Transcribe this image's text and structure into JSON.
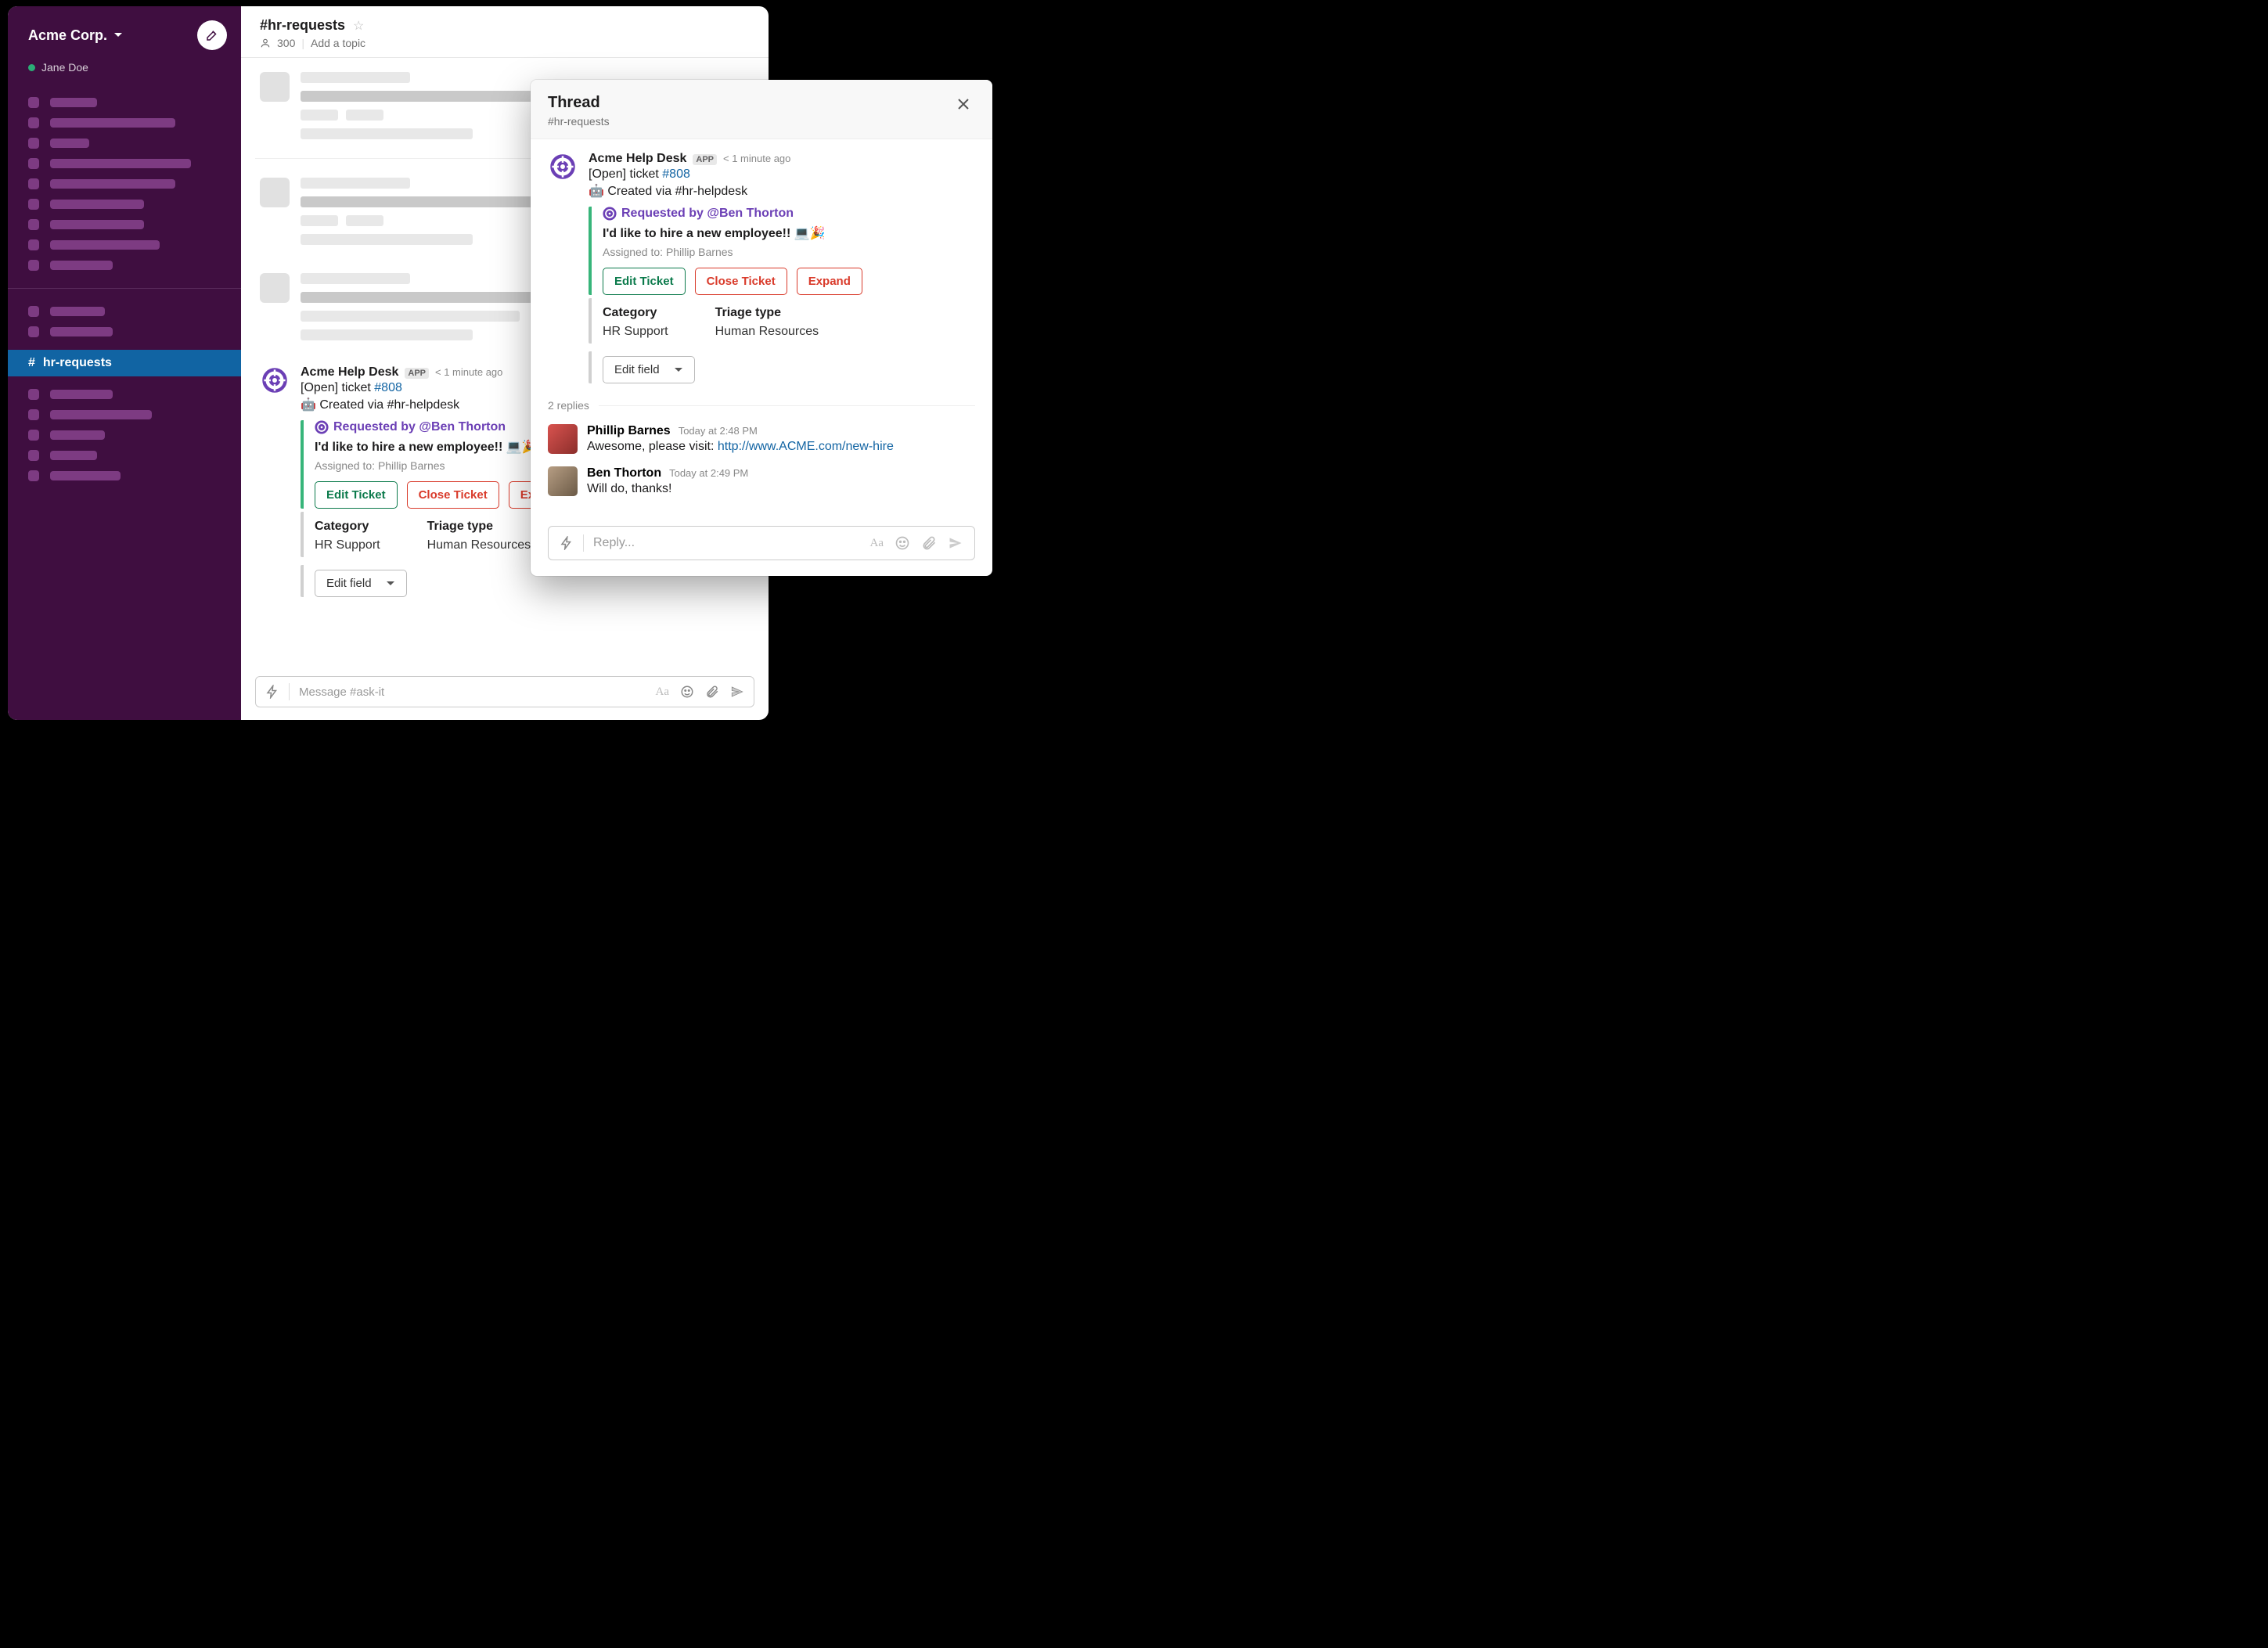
{
  "sidebar": {
    "workspace": "Acme Corp.",
    "user": "Jane Doe",
    "active_channel": "hr-requests",
    "skeleton_widths_top": [
      60,
      160,
      50,
      180,
      160,
      120,
      120,
      140,
      80
    ],
    "skeleton_widths_mid": [
      70,
      80
    ],
    "skeleton_widths_bottom": [
      80,
      130,
      70,
      60,
      90
    ]
  },
  "channel": {
    "name": "#hr-requests",
    "member_count": "300",
    "topic_placeholder": "Add a topic"
  },
  "ticket": {
    "author": "Acme Help Desk",
    "badge": "APP",
    "timestamp": "< 1 minute ago",
    "status_prefix": "[Open] ticket ",
    "ticket_number": "#808",
    "created_via": "Created via #hr-helpdesk",
    "requested_by": "Requested by @Ben Thorton",
    "description": "I'd like to hire a new employee!! 💻🎉",
    "assigned_to": "Assigned to: Phillip Barnes",
    "buttons": {
      "edit": "Edit Ticket",
      "close": "Close Ticket",
      "expand": "Expand"
    },
    "fields": {
      "category_label": "Category",
      "category_value": "HR Support",
      "triage_label": "Triage type",
      "triage_value": "Human Resources"
    },
    "edit_field": "Edit field"
  },
  "composer": {
    "placeholder": "Message #ask-it"
  },
  "thread": {
    "title": "Thread",
    "subtitle": "#hr-requests",
    "replies_label": "2 replies",
    "replies": [
      {
        "author": "Phillip Barnes",
        "time": "Today at 2:48 PM",
        "text_prefix": "Awesome, please visit: ",
        "link": "http://www.ACME.com/new-hire"
      },
      {
        "author": "Ben Thorton",
        "time": "Today at 2:49 PM",
        "text": "Will do, thanks!"
      }
    ],
    "reply_placeholder": "Reply..."
  }
}
